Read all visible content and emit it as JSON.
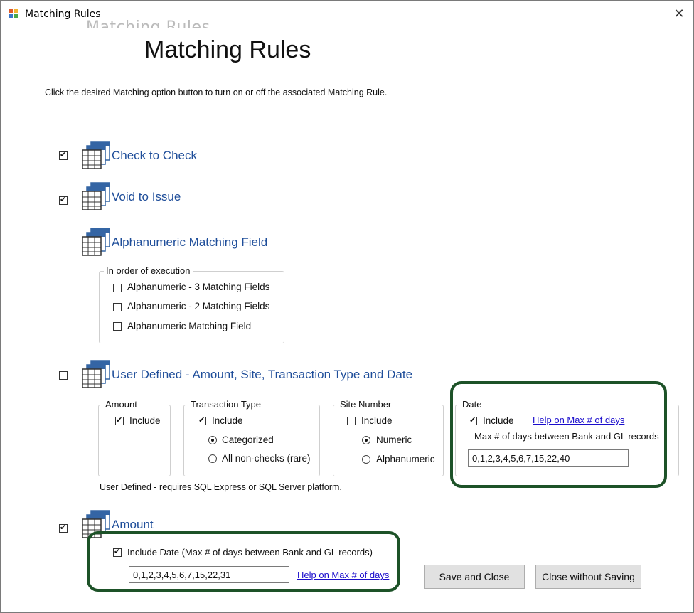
{
  "window": {
    "title": "Matching Rules",
    "close_glyph": "✕",
    "ghost_text": "Matching Rules"
  },
  "page": {
    "title": "Matching Rules",
    "instructions": "Click the desired Matching option button to turn on or off the associated Matching Rule."
  },
  "rules": {
    "check_to_check": {
      "label": "Check to Check",
      "checked": true,
      "icon": "table-grid-icon"
    },
    "void_to_issue": {
      "label": "Void to Issue",
      "checked": true,
      "icon": "table-grid-icon"
    },
    "alphanumeric": {
      "label": "Alphanumeric Matching Field",
      "icon": "table-grid-icon"
    },
    "user_defined": {
      "label": "User Defined - Amount, Site, Transaction Type and Date",
      "checked": false,
      "icon": "table-grid-icon"
    },
    "amount": {
      "label": "Amount",
      "checked": true,
      "icon": "table-grid-icon"
    }
  },
  "alphanumeric_group": {
    "legend": "In order of execution",
    "options": [
      {
        "label": "Alphanumeric - 3 Matching Fields",
        "checked": false
      },
      {
        "label": "Alphanumeric - 2 Matching Fields",
        "checked": false
      },
      {
        "label": "Alphanumeric Matching Field",
        "checked": false
      }
    ]
  },
  "user_defined_groups": {
    "amount": {
      "legend": "Amount",
      "include_label": "Include",
      "include_checked": true
    },
    "transaction_type": {
      "legend": "Transaction Type",
      "include_label": "Include",
      "include_checked": true,
      "radios": [
        {
          "label": "Categorized",
          "selected": true
        },
        {
          "label": "All non-checks (rare)",
          "selected": false
        }
      ]
    },
    "site_number": {
      "legend": "Site Number",
      "include_label": "Include",
      "include_checked": false,
      "radios": [
        {
          "label": "Numeric",
          "selected": true
        },
        {
          "label": "Alphanumeric",
          "selected": false
        }
      ]
    },
    "date": {
      "legend": "Date",
      "include_label": "Include",
      "include_checked": true,
      "help_link": "Help on Max # of days",
      "max_days_label": "Max # of days between Bank and GL records",
      "max_days_value": "0,1,2,3,4,5,6,7,15,22,40"
    },
    "note": "User Defined - requires SQL Express or SQL Server platform."
  },
  "amount_section": {
    "include_date_label": "Include Date (Max # of days between Bank and GL records)",
    "include_date_checked": true,
    "days_value": "0,1,2,3,4,5,6,7,15,22,31",
    "help_link": "Help on Max # of days"
  },
  "buttons": {
    "save_close": "Save and Close",
    "close_no_save": "Close without Saving"
  },
  "colors": {
    "rule_label": "#1f4e9a",
    "highlight_border": "#1d5228",
    "link": "#1a0dcc",
    "button_bg": "#e1e1e1"
  }
}
